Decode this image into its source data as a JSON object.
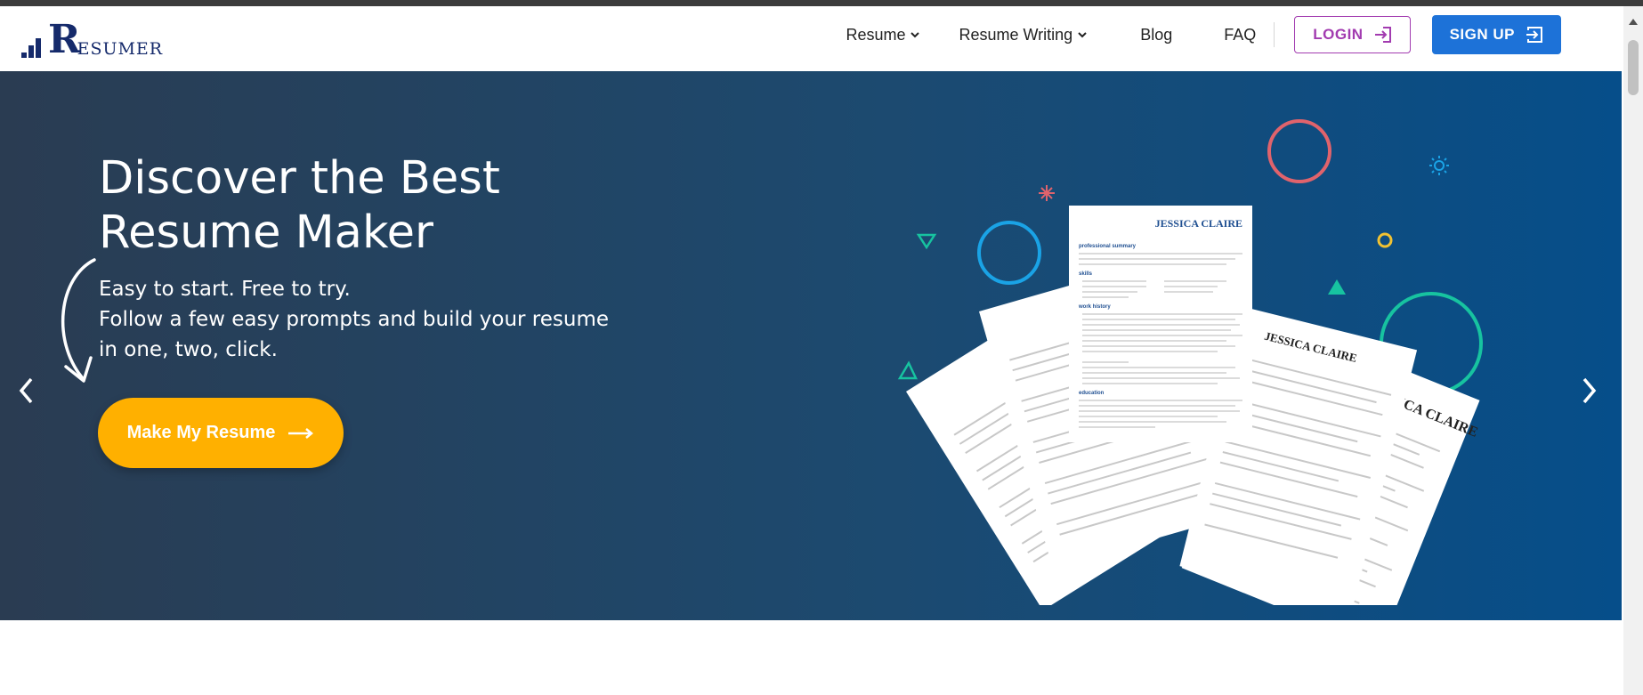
{
  "header": {
    "logo_text": "ESUMER",
    "logo_letter": "R",
    "nav": [
      {
        "label": "Resume",
        "has_dropdown": true
      },
      {
        "label": "Resume Writing",
        "has_dropdown": true
      },
      {
        "label": "Blog",
        "has_dropdown": false
      },
      {
        "label": "FAQ",
        "has_dropdown": false
      }
    ],
    "login_label": "LOGIN",
    "signup_label": "SIGN UP"
  },
  "hero": {
    "title_line1": "Discover the Best",
    "title_line2": "Resume Maker",
    "subtitle_line1": "Easy to start. Free to try.",
    "subtitle_line2": "Follow a few easy prompts and build your resume",
    "subtitle_line3": "in one, two, click.",
    "cta_label": "Make My Resume"
  },
  "resume_preview": {
    "name": "JESSICA CLAIRE",
    "sections": [
      "professional summary",
      "skills",
      "work history",
      "education"
    ]
  },
  "colors": {
    "brand_navy": "#152a6b",
    "login_accent": "#a23bb0",
    "signup_blue": "#1d72d8",
    "cta_yellow": "#ffb000",
    "hero_dark": "#2a3c52",
    "hero_blue": "#064e8a"
  },
  "icons": {
    "chevron": "chevron-down-icon",
    "login": "login-icon",
    "signup": "signup-icon",
    "cta": "arrow-right-icon",
    "prev": "chevron-left-icon",
    "next": "chevron-right-icon"
  }
}
